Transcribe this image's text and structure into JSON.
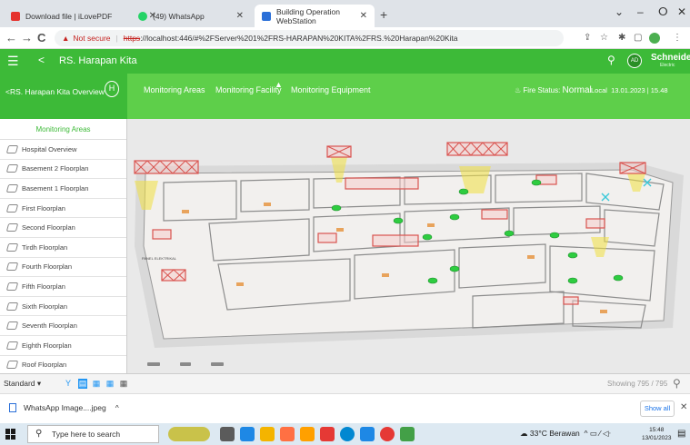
{
  "browser": {
    "tabs": [
      {
        "title": "Download file | iLovePDF",
        "favicon_color": "#e5322d"
      },
      {
        "title": "(49) WhatsApp",
        "favicon_color": "#25d366"
      },
      {
        "title": "Building Operation WebStation",
        "favicon_color": "#2a6fd8"
      }
    ],
    "new_tab_label": "+",
    "window_controls": {
      "collapse": "⌄",
      "minimize": "–",
      "restore": "ⵔ",
      "close": "✕"
    },
    "nav": {
      "back": "←",
      "forward": "→",
      "reload": "C"
    },
    "not_secure_label": "Not secure",
    "url_scheme": "https",
    "url_rest": "://localhost:446/#%2FServer%201%2FRS-HARAPAN%20KITA%2FRS.%20Harapan%20Kita",
    "url_icons": [
      "share-icon",
      "star-icon",
      "extension-icon",
      "sidepanel-icon",
      "profile-icon",
      "menu-icon"
    ]
  },
  "app": {
    "site_name": "RS. Harapan Kita",
    "menu_icon": "☰",
    "back_icon": "<",
    "search_icon": "⚲",
    "avatar_initials": "AD",
    "brand": "Schneider",
    "brand_sub": "Electric"
  },
  "header": {
    "overview_label": "RS. Harapan Kita Overview",
    "overview_back": "<",
    "overview_logo": "H",
    "tabs": [
      "Monitoring Areas",
      "Monitoring Facility",
      "Monitoring Equipment"
    ],
    "fire_status_label": "Fire Status:",
    "fire_status_value": "Normal",
    "local_label": "Local",
    "local_datetime": "13.01.2023 | 15.48"
  },
  "sidebar": {
    "title": "Monitoring Areas",
    "items": [
      "Hospital Overview",
      "Basement 2 Floorplan",
      "Basement 1 Floorplan",
      "First Floorplan",
      "Second Floorplan",
      "Tirdh Floorplan",
      "Fourth Floorplan",
      "Fifth Floorplan",
      "Sixth Floorplan",
      "Seventh Floorplan",
      "Eighth Floorplan",
      "Roof Floorplan"
    ]
  },
  "floorplan": {
    "panel_label": "PANEL ELEKTRIKAL"
  },
  "bottombar": {
    "view_select": "Standard",
    "showing": "Showing 795 / 795"
  },
  "downloads": {
    "file": "WhatsApp Image....jpeg",
    "caret": "^",
    "show_all": "Show all",
    "close": "✕"
  },
  "taskbar": {
    "search_placeholder": "Type here to search",
    "weather": "33°C Berawan",
    "tray_icons": "^ ▭ ⁄ ◁ᐧ",
    "time": "15:48",
    "date": "13/01/2023",
    "app_colors": [
      "#5b5b5b",
      "#1e88e5",
      "#f4b400",
      "#ff7043",
      "#ffa000",
      "#e53935",
      "#0288d1",
      "#1e88e5",
      "#e53935",
      "#43a047"
    ]
  },
  "colors": {
    "accent_green": "#3dba38",
    "header_green": "#5ecf4a",
    "alarm_red": "#d9534f",
    "sensor_green": "#2ecc40",
    "highlight_yellow": "#f0e040"
  }
}
